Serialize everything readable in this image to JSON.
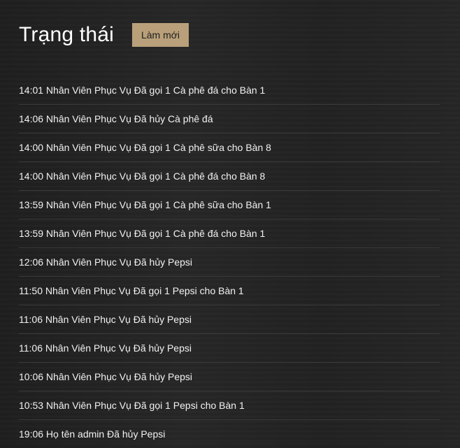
{
  "header": {
    "title": "Trạng thái",
    "refresh_label": "Làm mới"
  },
  "status_log": [
    "14:01 Nhân Viên Phục Vụ Đã gọi 1 Cà phê đá cho Bàn 1",
    "14:06 Nhân Viên Phục Vụ Đã hủy Cà phê đá",
    "14:00 Nhân Viên Phục Vụ Đã gọi 1 Cà phê sữa cho Bàn 8",
    "14:00 Nhân Viên Phục Vụ Đã gọi 1 Cà phê đá cho Bàn 8",
    "13:59 Nhân Viên Phục Vụ Đã gọi 1 Cà phê sữa cho Bàn 1",
    "13:59 Nhân Viên Phục Vụ Đã gọi 1 Cà phê đá cho Bàn 1",
    "12:06 Nhân Viên Phục Vụ Đã hủy Pepsi",
    "11:50 Nhân Viên Phục Vụ Đã gọi 1 Pepsi cho Bàn 1",
    "11:06 Nhân Viên Phục Vụ Đã hủy Pepsi",
    "11:06 Nhân Viên Phục Vụ Đã hủy Pepsi",
    "10:06 Nhân Viên Phục Vụ Đã hủy Pepsi",
    "10:53 Nhân Viên Phục Vụ Đã gọi 1 Pepsi cho Bàn 1",
    "19:06 Họ tên admin Đã hủy Pepsi"
  ],
  "colors": {
    "button_bg": "#b9a07a",
    "background": "#232323",
    "text": "#ffffff"
  }
}
